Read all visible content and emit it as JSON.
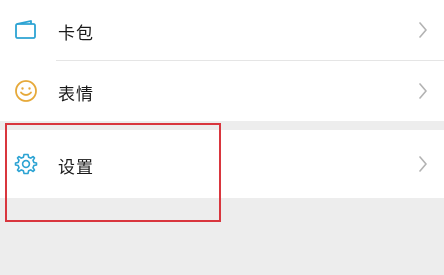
{
  "menu": {
    "items": [
      {
        "label": "卡包",
        "icon": "wallet-icon"
      },
      {
        "label": "表情",
        "icon": "smiley-icon"
      },
      {
        "label": "设置",
        "icon": "gear-icon"
      }
    ]
  },
  "colors": {
    "icon_accent": "#2ca3d3",
    "emoji_accent": "#e6a93a",
    "highlight": "#d9363e",
    "background": "#ededed",
    "row_background": "#ffffff"
  },
  "chevron_icon": "chevron-right-icon"
}
